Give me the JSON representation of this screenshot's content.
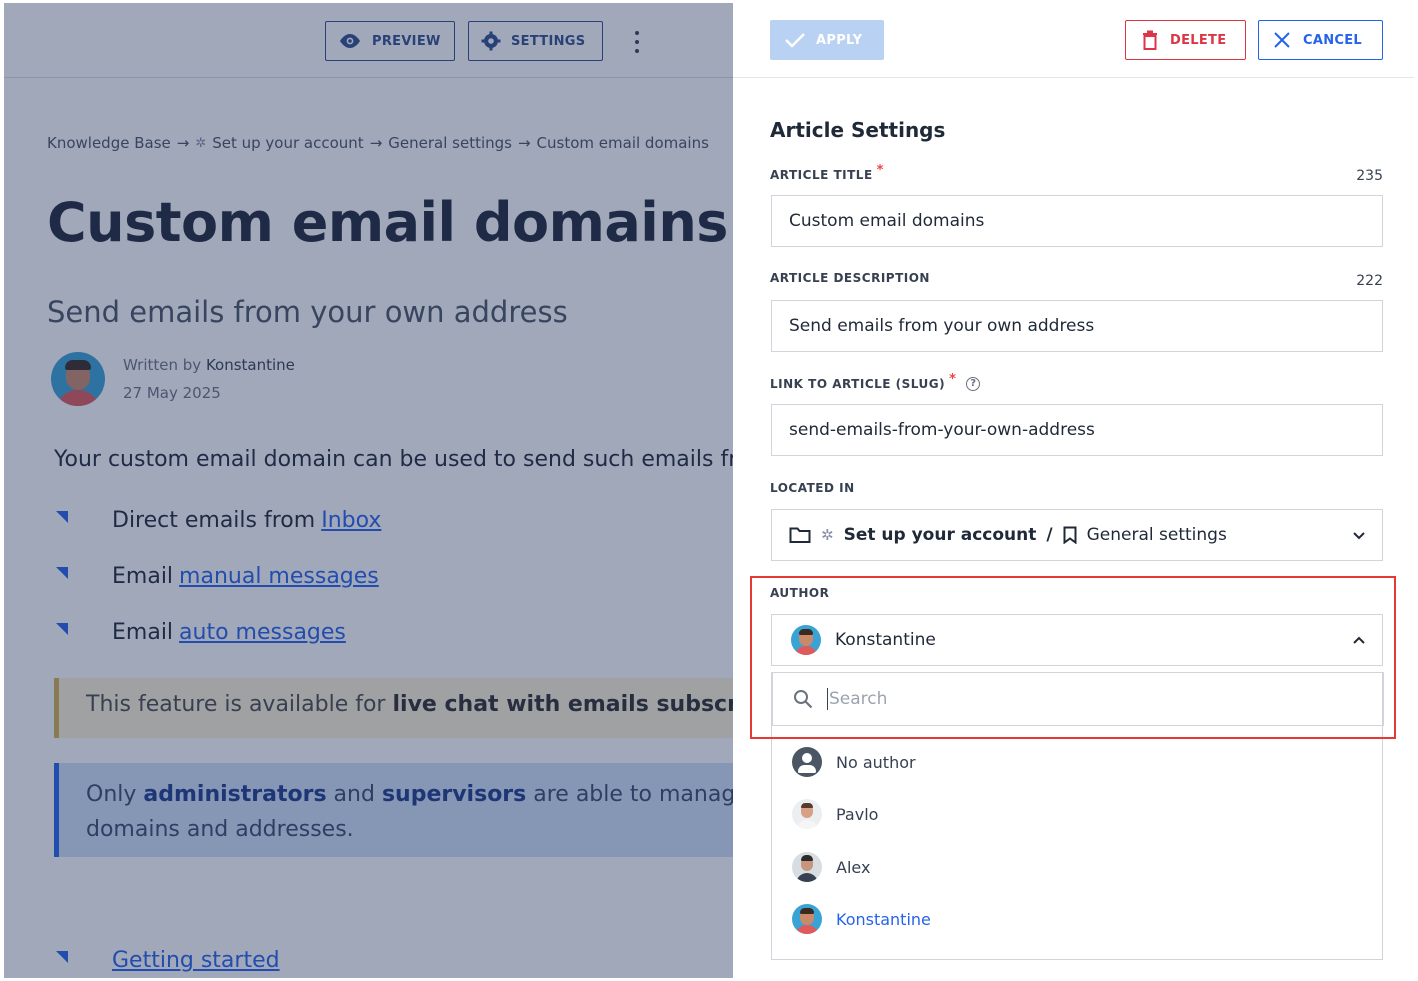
{
  "article": {
    "toolbar": {
      "preview_label": "PREVIEW",
      "settings_label": "SETTINGS"
    },
    "breadcrumb": [
      "Knowledge Base",
      "Set up your account",
      "General settings",
      "Custom email domains"
    ],
    "breadcrumb_sep": "→",
    "title": "Custom email domains",
    "subtitle": "Send emails from your own address",
    "written_by_prefix": "Written by",
    "author": "Konstantine",
    "date": "27 May 2025",
    "intro": "Your custom email domain can be used to send such emails fro",
    "bullets": [
      {
        "text": "Direct emails from",
        "link": "Inbox"
      },
      {
        "text": "Email",
        "link": "manual messages"
      },
      {
        "text": "Email",
        "link": "auto messages"
      }
    ],
    "callout_yellow": {
      "pre": "This feature is available for ",
      "bold": "live chat with emails subscripti"
    },
    "callout_blue": {
      "pre": "Only ",
      "bold1": "administrators",
      "mid": " and ",
      "bold2": "supervisors",
      "post": " are able to manage cu",
      "line2": "domains and addresses."
    },
    "next_link": "Getting started"
  },
  "panel": {
    "apply_label": "APPLY",
    "delete_label": "DELETE",
    "cancel_label": "CANCEL",
    "heading": "Article Settings",
    "title_field": {
      "label": "ARTICLE TITLE",
      "required": "*",
      "count": "235",
      "value": "Custom email domains"
    },
    "description_field": {
      "label": "ARTICLE DESCRIPTION",
      "count": "222",
      "value": "Send emails from your own address"
    },
    "slug_field": {
      "label": "LINK TO ARTICLE (SLUG)",
      "required": "*",
      "help": "?",
      "value": "send-emails-from-your-own-address"
    },
    "located_field": {
      "label": "LOCATED IN",
      "category": "Set up your account",
      "sep": "/",
      "section": "General settings"
    },
    "author_field": {
      "label": "AUTHOR",
      "selected": "Konstantine",
      "search_placeholder": "Search",
      "options": [
        "No author",
        "Pavlo",
        "Alex",
        "Konstantine"
      ]
    }
  },
  "colors": {
    "accent": "#2563eb",
    "danger": "#dc3545",
    "highlight": "#e53935",
    "overlay": "#1e305a"
  }
}
